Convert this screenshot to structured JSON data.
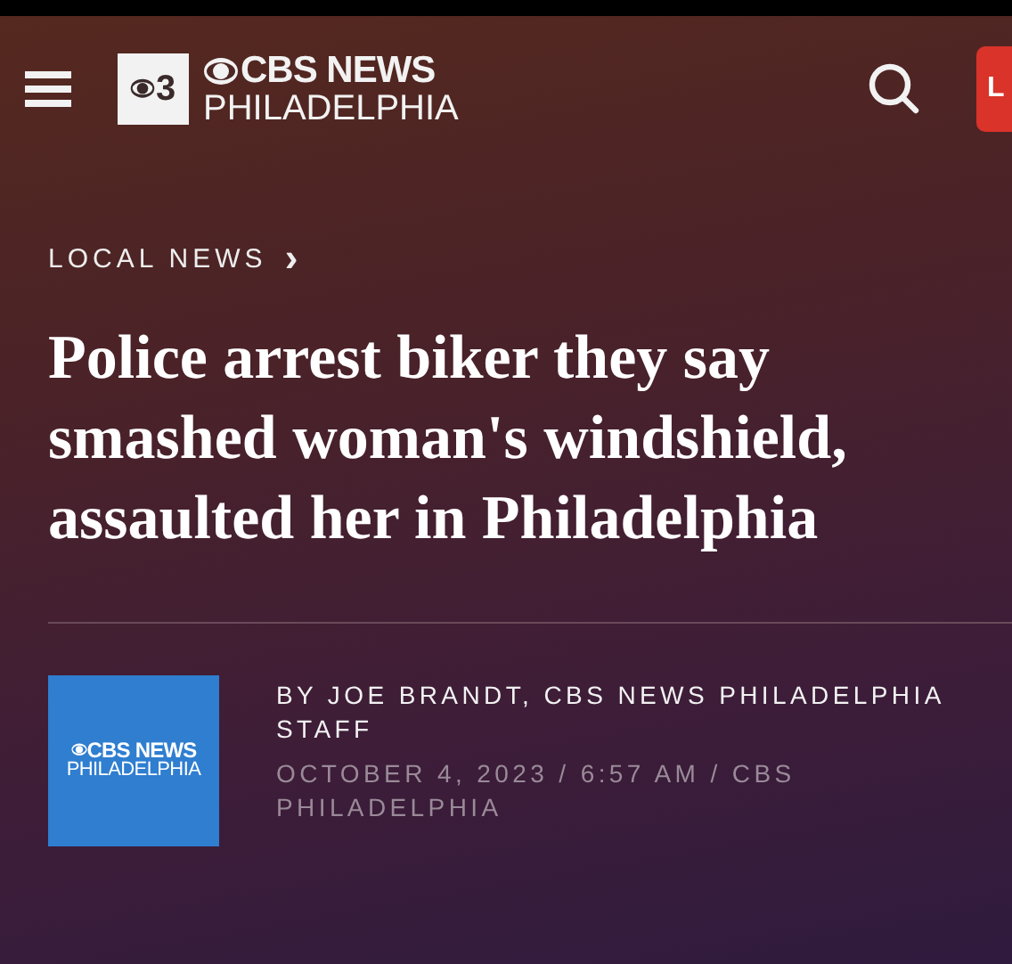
{
  "header": {
    "logo": {
      "badge": "3",
      "title": "CBS NEWS",
      "subtitle": "PHILADELPHIA"
    },
    "live_button": "L"
  },
  "article": {
    "section": "LOCAL NEWS",
    "chevron": "›",
    "headline": "Police arrest biker they say smashed woman's windshield, assaulted her in Philadelphia",
    "author_logo": {
      "title": "CBS NEWS",
      "subtitle": "PHILADELPHIA"
    },
    "byline": "BY JOE BRANDT, CBS NEWS PHILADELPHIA STAFF",
    "dateline": "OCTOBER 4, 2023 / 6:57 AM / CBS PHILADELPHIA"
  }
}
